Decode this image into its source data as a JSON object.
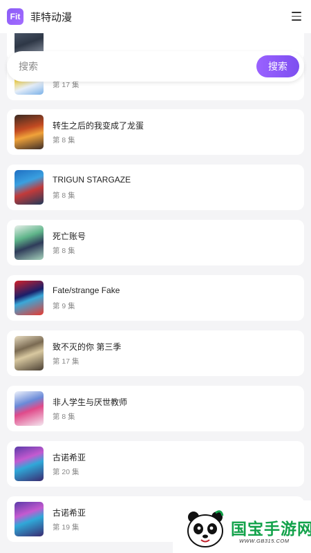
{
  "header": {
    "logo_text": "Fit",
    "app_title": "菲特动漫"
  },
  "search": {
    "placeholder": "搜索",
    "value": "",
    "button_label": "搜索"
  },
  "list": [
    {
      "title": "",
      "episode": ""
    },
    {
      "title": "",
      "episode": "第 17 集"
    },
    {
      "title": "转生之后的我变成了龙蛋",
      "episode": "第 8 集"
    },
    {
      "title": "TRIGUN STARGAZE",
      "episode": "第 8 集"
    },
    {
      "title": "死亡账号",
      "episode": "第 8 集"
    },
    {
      "title": "Fate/strange Fake",
      "episode": "第 9 集"
    },
    {
      "title": "致不灭的你 第三季",
      "episode": "第 17 集"
    },
    {
      "title": "非人学生与厌世教师",
      "episode": "第 8 集"
    },
    {
      "title": "古诺希亚",
      "episode": "第 20 集"
    },
    {
      "title": "古诺希亚",
      "episode": "第 19 集"
    }
  ],
  "watermark": {
    "text": "国宝手游网",
    "url": "WWW.GB315.COM"
  },
  "colors": {
    "accent": "#8a5cf6",
    "background": "#f4f4f6",
    "card": "#ffffff"
  }
}
